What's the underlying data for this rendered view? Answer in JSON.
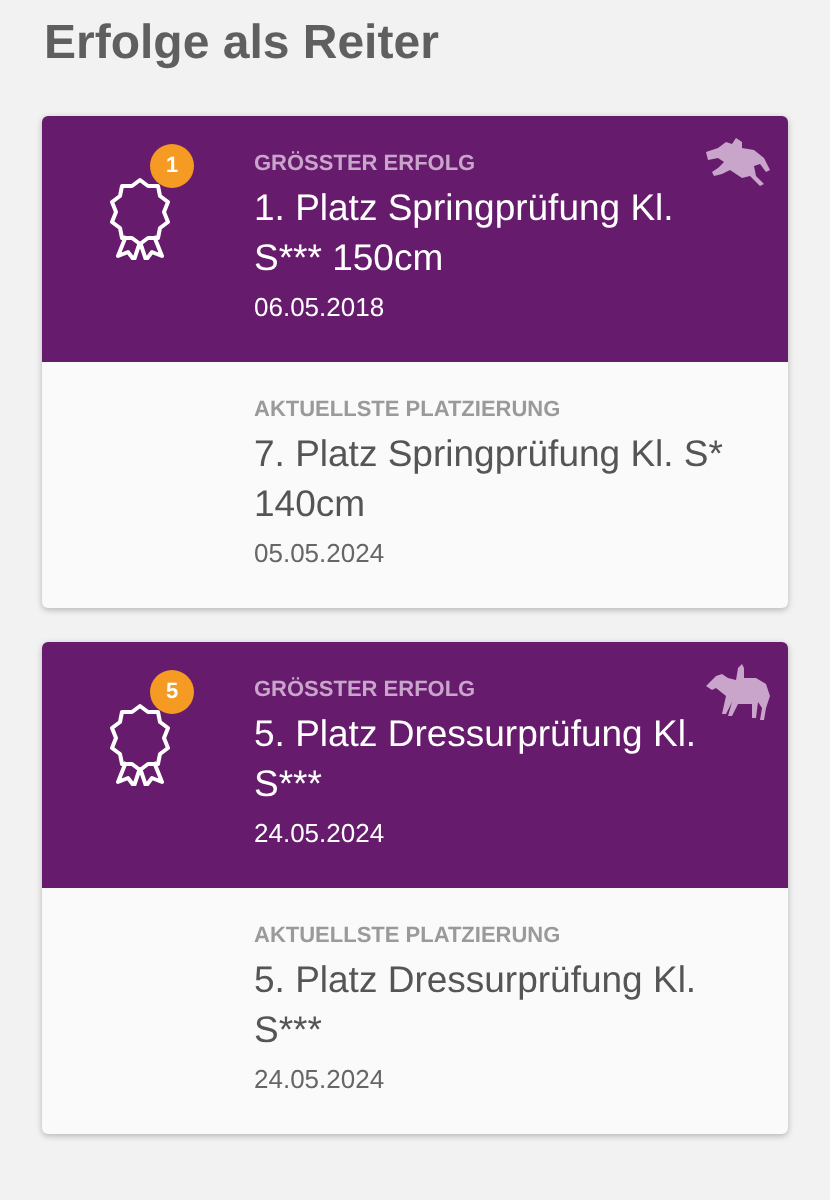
{
  "title": "Erfolge als Reiter",
  "cards": [
    {
      "kind": "jumping",
      "best": {
        "badge": "1",
        "label": "GRÖSSTER ERFOLG",
        "result": "1. Platz Springprüfung Kl. S*** 150cm",
        "date": "06.05.2018"
      },
      "latest": {
        "label": "AKTUELLSTE PLATZIERUNG",
        "result": "7. Platz Springprüfung Kl. S* 140cm",
        "date": "05.05.2024"
      }
    },
    {
      "kind": "dressage",
      "best": {
        "badge": "5",
        "label": "GRÖSSTER ERFOLG",
        "result": "5. Platz Dressurprüfung Kl. S***",
        "date": "24.05.2024"
      },
      "latest": {
        "label": "AKTUELLSTE PLATZIERUNG",
        "result": "5. Platz Dressurprüfung Kl. S***",
        "date": "24.05.2024"
      }
    }
  ]
}
